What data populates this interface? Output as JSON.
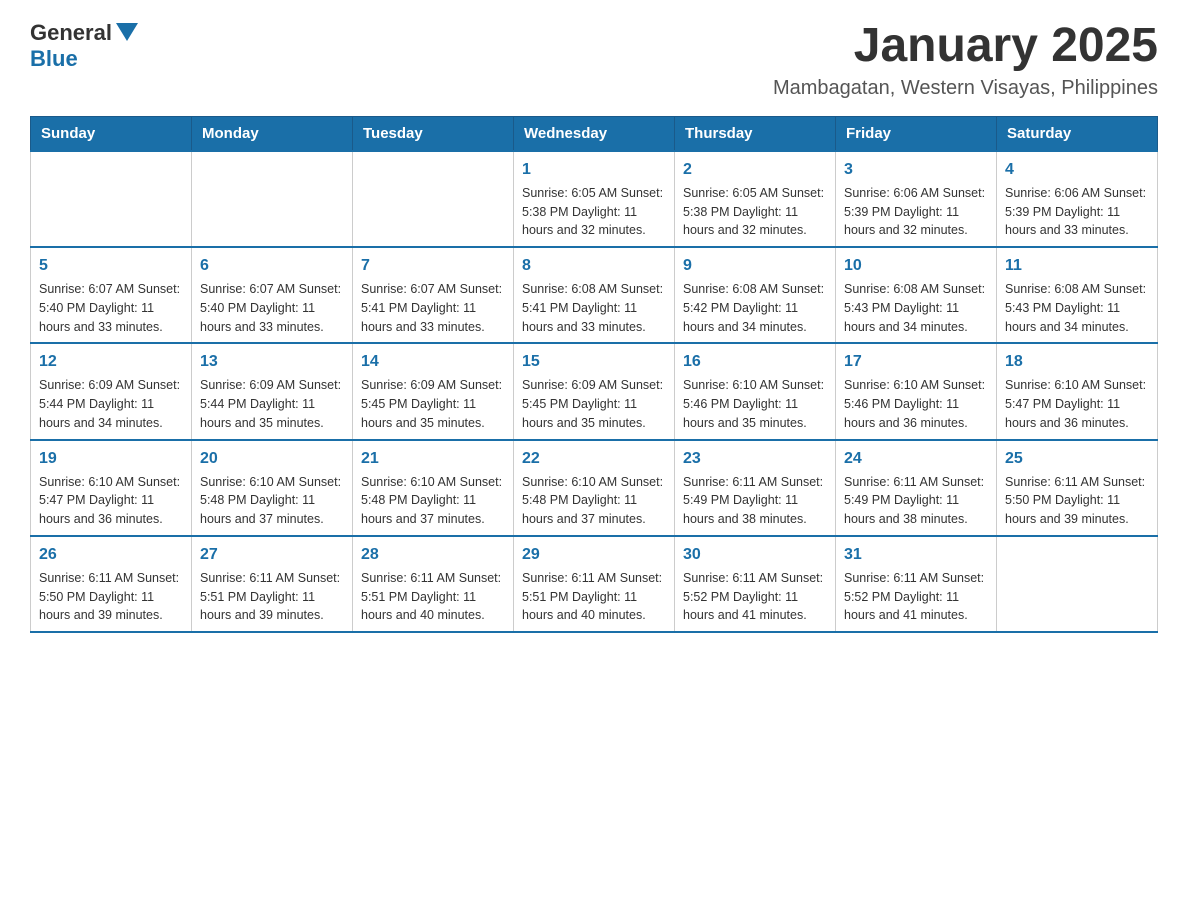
{
  "header": {
    "logo_general": "General",
    "logo_blue": "Blue",
    "month_title": "January 2025",
    "location": "Mambagatan, Western Visayas, Philippines"
  },
  "days_of_week": [
    "Sunday",
    "Monday",
    "Tuesday",
    "Wednesday",
    "Thursday",
    "Friday",
    "Saturday"
  ],
  "weeks": [
    [
      {
        "day": "",
        "info": ""
      },
      {
        "day": "",
        "info": ""
      },
      {
        "day": "",
        "info": ""
      },
      {
        "day": "1",
        "info": "Sunrise: 6:05 AM\nSunset: 5:38 PM\nDaylight: 11 hours and 32 minutes."
      },
      {
        "day": "2",
        "info": "Sunrise: 6:05 AM\nSunset: 5:38 PM\nDaylight: 11 hours and 32 minutes."
      },
      {
        "day": "3",
        "info": "Sunrise: 6:06 AM\nSunset: 5:39 PM\nDaylight: 11 hours and 32 minutes."
      },
      {
        "day": "4",
        "info": "Sunrise: 6:06 AM\nSunset: 5:39 PM\nDaylight: 11 hours and 33 minutes."
      }
    ],
    [
      {
        "day": "5",
        "info": "Sunrise: 6:07 AM\nSunset: 5:40 PM\nDaylight: 11 hours and 33 minutes."
      },
      {
        "day": "6",
        "info": "Sunrise: 6:07 AM\nSunset: 5:40 PM\nDaylight: 11 hours and 33 minutes."
      },
      {
        "day": "7",
        "info": "Sunrise: 6:07 AM\nSunset: 5:41 PM\nDaylight: 11 hours and 33 minutes."
      },
      {
        "day": "8",
        "info": "Sunrise: 6:08 AM\nSunset: 5:41 PM\nDaylight: 11 hours and 33 minutes."
      },
      {
        "day": "9",
        "info": "Sunrise: 6:08 AM\nSunset: 5:42 PM\nDaylight: 11 hours and 34 minutes."
      },
      {
        "day": "10",
        "info": "Sunrise: 6:08 AM\nSunset: 5:43 PM\nDaylight: 11 hours and 34 minutes."
      },
      {
        "day": "11",
        "info": "Sunrise: 6:08 AM\nSunset: 5:43 PM\nDaylight: 11 hours and 34 minutes."
      }
    ],
    [
      {
        "day": "12",
        "info": "Sunrise: 6:09 AM\nSunset: 5:44 PM\nDaylight: 11 hours and 34 minutes."
      },
      {
        "day": "13",
        "info": "Sunrise: 6:09 AM\nSunset: 5:44 PM\nDaylight: 11 hours and 35 minutes."
      },
      {
        "day": "14",
        "info": "Sunrise: 6:09 AM\nSunset: 5:45 PM\nDaylight: 11 hours and 35 minutes."
      },
      {
        "day": "15",
        "info": "Sunrise: 6:09 AM\nSunset: 5:45 PM\nDaylight: 11 hours and 35 minutes."
      },
      {
        "day": "16",
        "info": "Sunrise: 6:10 AM\nSunset: 5:46 PM\nDaylight: 11 hours and 35 minutes."
      },
      {
        "day": "17",
        "info": "Sunrise: 6:10 AM\nSunset: 5:46 PM\nDaylight: 11 hours and 36 minutes."
      },
      {
        "day": "18",
        "info": "Sunrise: 6:10 AM\nSunset: 5:47 PM\nDaylight: 11 hours and 36 minutes."
      }
    ],
    [
      {
        "day": "19",
        "info": "Sunrise: 6:10 AM\nSunset: 5:47 PM\nDaylight: 11 hours and 36 minutes."
      },
      {
        "day": "20",
        "info": "Sunrise: 6:10 AM\nSunset: 5:48 PM\nDaylight: 11 hours and 37 minutes."
      },
      {
        "day": "21",
        "info": "Sunrise: 6:10 AM\nSunset: 5:48 PM\nDaylight: 11 hours and 37 minutes."
      },
      {
        "day": "22",
        "info": "Sunrise: 6:10 AM\nSunset: 5:48 PM\nDaylight: 11 hours and 37 minutes."
      },
      {
        "day": "23",
        "info": "Sunrise: 6:11 AM\nSunset: 5:49 PM\nDaylight: 11 hours and 38 minutes."
      },
      {
        "day": "24",
        "info": "Sunrise: 6:11 AM\nSunset: 5:49 PM\nDaylight: 11 hours and 38 minutes."
      },
      {
        "day": "25",
        "info": "Sunrise: 6:11 AM\nSunset: 5:50 PM\nDaylight: 11 hours and 39 minutes."
      }
    ],
    [
      {
        "day": "26",
        "info": "Sunrise: 6:11 AM\nSunset: 5:50 PM\nDaylight: 11 hours and 39 minutes."
      },
      {
        "day": "27",
        "info": "Sunrise: 6:11 AM\nSunset: 5:51 PM\nDaylight: 11 hours and 39 minutes."
      },
      {
        "day": "28",
        "info": "Sunrise: 6:11 AM\nSunset: 5:51 PM\nDaylight: 11 hours and 40 minutes."
      },
      {
        "day": "29",
        "info": "Sunrise: 6:11 AM\nSunset: 5:51 PM\nDaylight: 11 hours and 40 minutes."
      },
      {
        "day": "30",
        "info": "Sunrise: 6:11 AM\nSunset: 5:52 PM\nDaylight: 11 hours and 41 minutes."
      },
      {
        "day": "31",
        "info": "Sunrise: 6:11 AM\nSunset: 5:52 PM\nDaylight: 11 hours and 41 minutes."
      },
      {
        "day": "",
        "info": ""
      }
    ]
  ]
}
